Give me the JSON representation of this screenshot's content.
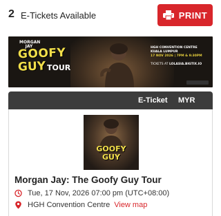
{
  "header": {
    "ticket_count": "2",
    "ticket_label": "E-Tickets Available",
    "print_label": "PRINT"
  },
  "banner": {
    "logo_small_line1": "MORGAN",
    "logo_small_line2": "JAY",
    "goofy": "GOOFY",
    "guy": "GUY",
    "tour": "TOUR",
    "venue": "HGH CONVENTION CENTRE",
    "city": "KUALA LUMPUR",
    "datetime": "17 NOV 2026 | 7PM & 9:30PM",
    "tickets_prefix": "TICKETS AT",
    "tickets_site": "LOLASIA.BIGTIX.IO"
  },
  "ticket_bar": {
    "label": "E-Ticket",
    "currency": "MYR"
  },
  "poster": {
    "goofy": "GOOFY",
    "guy": "GUY"
  },
  "event": {
    "title": "Morgan Jay: The Goofy Guy Tour",
    "date": "Tue, 17 Nov, 2026 07:00 pm (UTC+08:00)",
    "venue": "HGH Convention Centre",
    "view_map": "View map"
  },
  "colors": {
    "accent": "#d8262b",
    "dark_bar": "#3c3c3c",
    "banner_yellow": "#f2df4a"
  },
  "icons": {
    "print": "printer-icon",
    "date": "clock-icon",
    "venue": "location-pin-icon"
  }
}
